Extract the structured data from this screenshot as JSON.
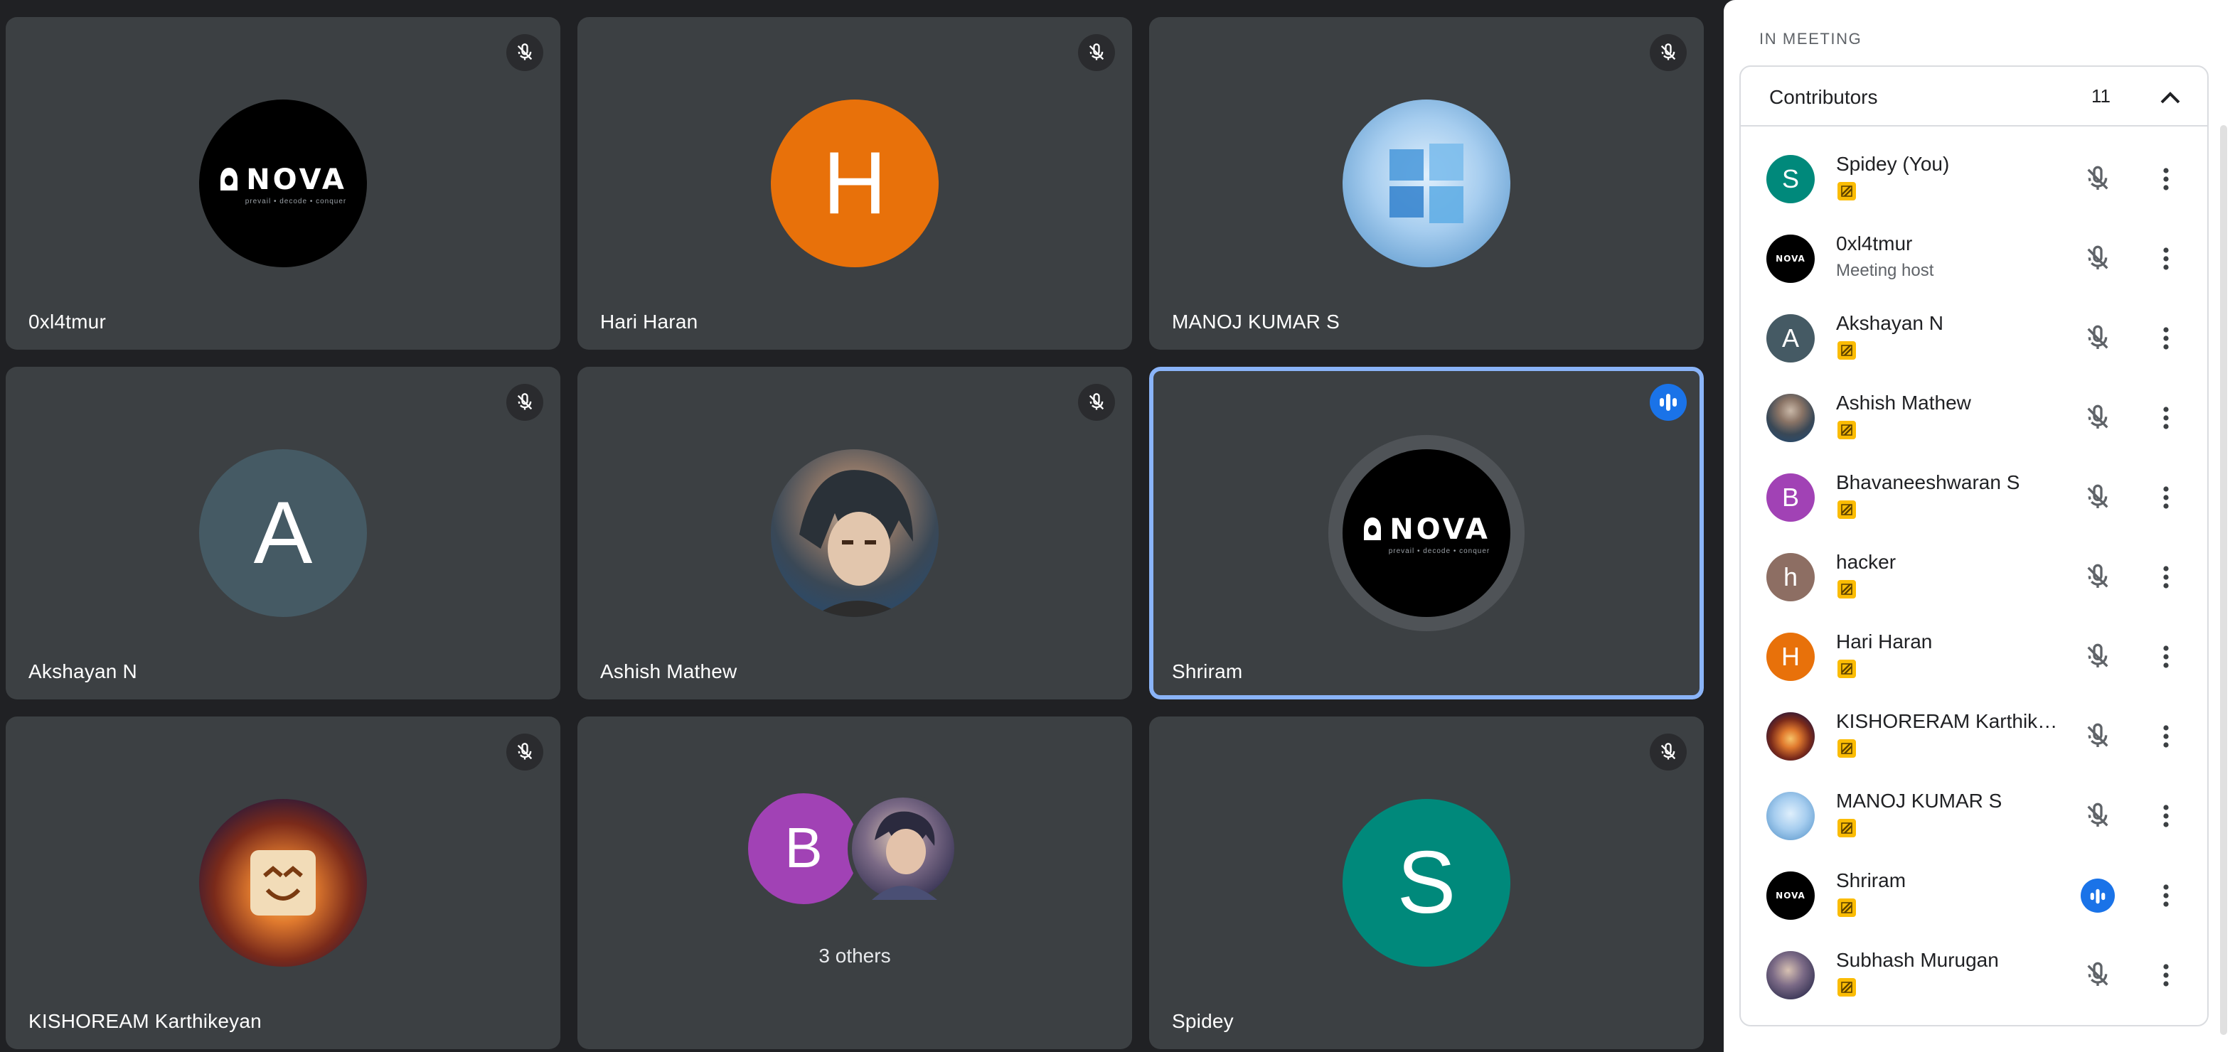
{
  "tiles": [
    {
      "name": "0xl4tmur",
      "avatar": "nova-logo",
      "mic": "muted"
    },
    {
      "name": "Hari Haran",
      "avatar_letter": "H",
      "avatar_color": "#e8710a",
      "mic": "muted"
    },
    {
      "name": "MANOJ KUMAR S",
      "avatar": "windows-wallpaper-photo",
      "mic": "muted"
    },
    {
      "name": "Akshayan N",
      "avatar_letter": "A",
      "avatar_color": "#455a64",
      "mic": "muted"
    },
    {
      "name": "Ashish Mathew",
      "avatar": "anime-character-photo",
      "mic": "muted"
    },
    {
      "name": "Shriram",
      "avatar": "nova-logo",
      "mic": "speaking",
      "active": true
    },
    {
      "name": "KISHOREAM Karthikeyan",
      "avatar": "marshmello-photo",
      "mic": "muted"
    },
    {
      "others_label": "3 others",
      "avatar_letter": "B",
      "avatar_color": "#a142b5"
    },
    {
      "name": "Spidey",
      "avatar_letter": "S",
      "avatar_color": "#00897b",
      "mic": "muted"
    }
  ],
  "nova_logo": {
    "text": "NOVA",
    "tagline": "prevail • decode • conquer"
  },
  "panel": {
    "heading": "IN MEETING",
    "section_title": "Contributors",
    "section_count": "11",
    "participants": [
      {
        "name": "Spidey (You)",
        "avatar_letter": "S",
        "avatar_color": "#00897b",
        "status": "muted"
      },
      {
        "name": "0xl4tmur",
        "subtitle": "Meeting host",
        "avatar": "nova-logo",
        "status": "muted"
      },
      {
        "name": "Akshayan N",
        "avatar_letter": "A",
        "avatar_color": "#455a64",
        "status": "muted"
      },
      {
        "name": "Ashish Mathew",
        "avatar": "anime-character-photo",
        "status": "muted"
      },
      {
        "name": "Bhavaneeshwaran S",
        "avatar_letter": "B",
        "avatar_color": "#a142b5",
        "status": "muted"
      },
      {
        "name": "hacker",
        "avatar_letter": "h",
        "avatar_color": "#8d6e63",
        "status": "muted"
      },
      {
        "name": "Hari Haran",
        "avatar_letter": "H",
        "avatar_color": "#e8710a",
        "status": "muted"
      },
      {
        "name": "KISHORERAM Karthikeyan",
        "avatar": "marshmello-photo",
        "status": "muted"
      },
      {
        "name": "MANOJ KUMAR S",
        "avatar": "windows-wallpaper-photo",
        "status": "muted"
      },
      {
        "name": "Shriram",
        "avatar": "nova-logo",
        "status": "speaking"
      },
      {
        "name": "Subhash Murugan",
        "avatar": "character-photo",
        "status": "muted"
      }
    ]
  }
}
